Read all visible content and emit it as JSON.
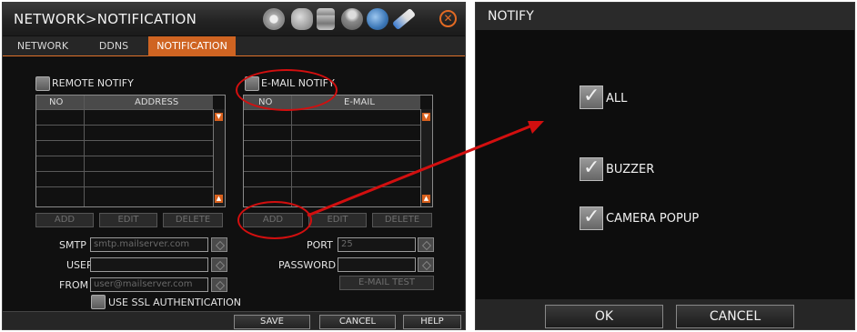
{
  "network_window": {
    "title": "NETWORK>NOTIFICATION",
    "toolbar_icons": [
      "gear-icon",
      "tools-icon",
      "database-icon",
      "joystick-icon",
      "globe-icon",
      "brush-icon"
    ],
    "close_icon": "close-icon",
    "tabs": [
      {
        "label": "NETWORK",
        "active": false
      },
      {
        "label": "DDNS",
        "active": false
      },
      {
        "label": "NOTIFICATION",
        "active": true
      }
    ],
    "remote_notify": {
      "label": "REMOTE NOTIFY",
      "checked": false,
      "columns": [
        "NO",
        "ADDRESS"
      ],
      "buttons": {
        "add": "ADD",
        "edit": "EDIT",
        "delete": "DELETE"
      }
    },
    "email_notify": {
      "label": "E-MAIL NOTIFY",
      "checked": false,
      "columns": [
        "NO",
        "E-MAIL"
      ],
      "buttons": {
        "add": "ADD",
        "edit": "EDIT",
        "delete": "DELETE"
      }
    },
    "smtp": {
      "smtp_label": "SMTP",
      "smtp_placeholder": "smtp.mailserver.com",
      "user_label": "USER",
      "user_value": "",
      "from_label": "FROM",
      "from_placeholder": "user@mailserver.com",
      "port_label": "PORT",
      "port_value": "25",
      "password_label": "PASSWORD",
      "password_value": "",
      "email_test": "E-MAIL TEST",
      "ssl_label": "USE SSL AUTHENTICATION"
    },
    "bottom_buttons": {
      "save": "SAVE",
      "cancel": "CANCEL",
      "help": "HELP"
    }
  },
  "notify_window": {
    "title": "NOTIFY",
    "options": [
      {
        "label": "ALL",
        "checked": true
      },
      {
        "label": "BUZZER",
        "checked": true
      },
      {
        "label": "CAMERA POPUP",
        "checked": true
      }
    ],
    "buttons": {
      "ok": "OK",
      "cancel": "CANCEL"
    }
  },
  "annotation_color": "#d20f0f"
}
